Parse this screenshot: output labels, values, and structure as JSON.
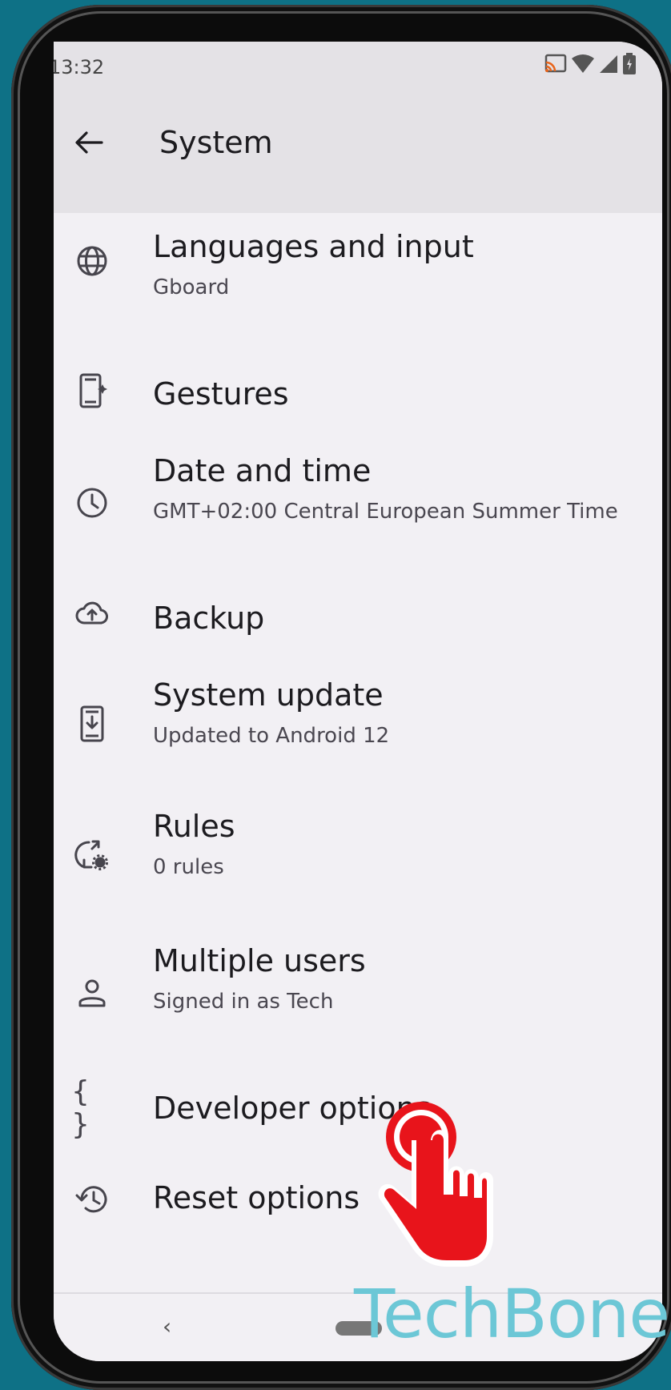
{
  "status": {
    "time": "13:32",
    "icons": [
      "cast-icon",
      "wifi-icon",
      "signal-icon",
      "battery-icon"
    ]
  },
  "appbar": {
    "title": "System",
    "back_icon": "arrow-left-icon"
  },
  "items": [
    {
      "title": "Languages and input",
      "subtitle": "Gboard",
      "icon": "globe-icon"
    },
    {
      "title": "Gestures",
      "subtitle": "",
      "icon": "gestures-phone-icon"
    },
    {
      "title": "Date and time",
      "subtitle": "GMT+02:00 Central European Summer Time",
      "icon": "clock-icon"
    },
    {
      "title": "Backup",
      "subtitle": "",
      "icon": "cloud-upload-icon"
    },
    {
      "title": "System update",
      "subtitle": "Updated to Android 12",
      "icon": "system-update-icon"
    },
    {
      "title": "Rules",
      "subtitle": "0 rules",
      "icon": "rules-icon"
    },
    {
      "title": "Multiple users",
      "subtitle": "Signed in as Tech",
      "icon": "person-icon"
    },
    {
      "title": "Developer options",
      "subtitle": "",
      "icon": "braces-icon"
    },
    {
      "title": "Reset options",
      "subtitle": "",
      "icon": "history-icon"
    }
  ],
  "navbar": {
    "back_glyph": "‹"
  },
  "watermark": "TechBone",
  "colors": {
    "outer_bg": "#0e7186",
    "screen_bg": "#f2f0f4",
    "appbar_bg": "#e4e2e6",
    "tap_red": "#e8141b",
    "watermark": "#6cc7d6"
  }
}
